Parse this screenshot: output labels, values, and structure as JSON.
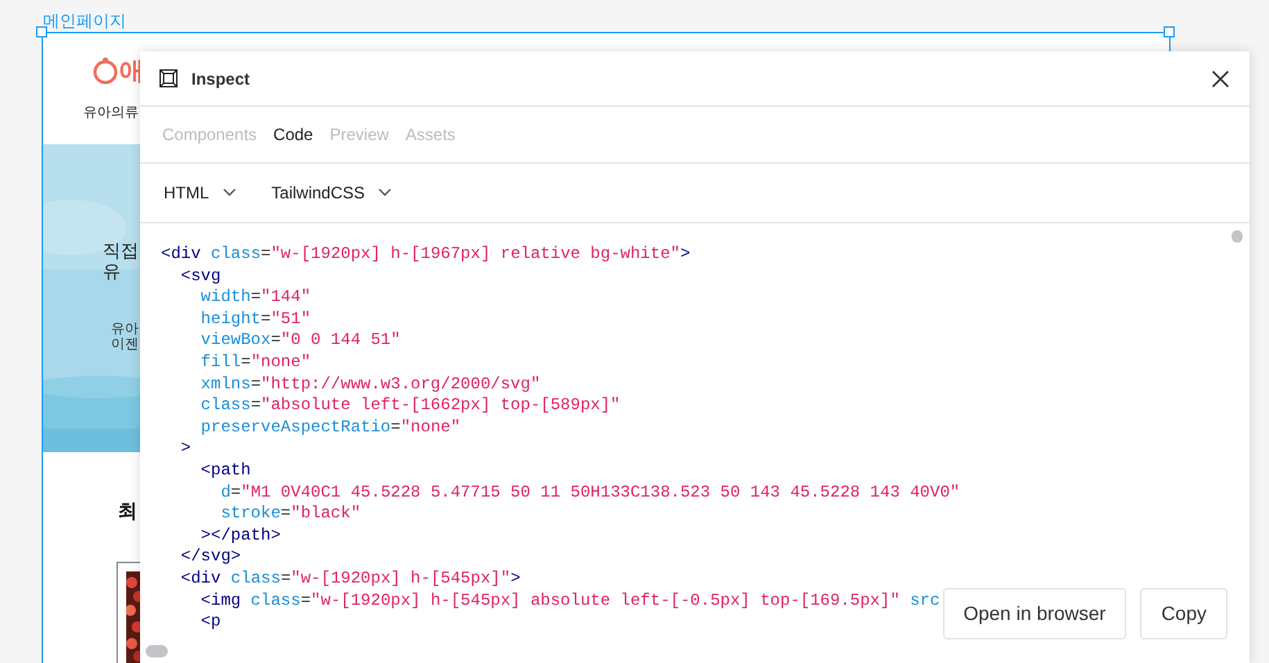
{
  "canvas": {
    "frame_label": "메인페이지",
    "page": {
      "logo_text": "애",
      "nav": [
        "유아의류"
      ],
      "hero": {
        "kind": "picture",
        "heading_lines": [
          "직접",
          "유"
        ],
        "subtext_lines": [
          "유아",
          "이젠"
        ]
      },
      "section_heading": "최",
      "product": {
        "kind": "picture"
      }
    }
  },
  "dialog": {
    "title": "Inspect",
    "tabs": [
      {
        "label": "Components",
        "selected": false
      },
      {
        "label": "Code",
        "selected": true
      },
      {
        "label": "Preview",
        "selected": false
      },
      {
        "label": "Assets",
        "selected": false
      }
    ],
    "dropdowns": [
      {
        "label": "HTML"
      },
      {
        "label": "TailwindCSS"
      }
    ],
    "code_lines": [
      [
        {
          "kind": "tag",
          "text": "<div"
        },
        {
          "kind": "attr",
          "text": " class"
        },
        {
          "kind": "plain",
          "text": "="
        },
        {
          "kind": "value",
          "text": "\"w-[1920px] h-[1967px] relative bg-white\""
        },
        {
          "kind": "tag",
          "text": ">"
        }
      ],
      [
        {
          "kind": "tag",
          "text": "  <svg"
        }
      ],
      [
        {
          "kind": "attr",
          "text": "    width"
        },
        {
          "kind": "plain",
          "text": "="
        },
        {
          "kind": "value",
          "text": "\"144\""
        }
      ],
      [
        {
          "kind": "attr",
          "text": "    height"
        },
        {
          "kind": "plain",
          "text": "="
        },
        {
          "kind": "value",
          "text": "\"51\""
        }
      ],
      [
        {
          "kind": "attr",
          "text": "    viewBox"
        },
        {
          "kind": "plain",
          "text": "="
        },
        {
          "kind": "value",
          "text": "\"0 0 144 51\""
        }
      ],
      [
        {
          "kind": "attr",
          "text": "    fill"
        },
        {
          "kind": "plain",
          "text": "="
        },
        {
          "kind": "value",
          "text": "\"none\""
        }
      ],
      [
        {
          "kind": "attr",
          "text": "    xmlns"
        },
        {
          "kind": "plain",
          "text": "="
        },
        {
          "kind": "value",
          "text": "\"http://www.w3.org/2000/svg\""
        }
      ],
      [
        {
          "kind": "attr",
          "text": "    class"
        },
        {
          "kind": "plain",
          "text": "="
        },
        {
          "kind": "value",
          "text": "\"absolute left-[1662px] top-[589px]\""
        }
      ],
      [
        {
          "kind": "attr",
          "text": "    preserveAspectRatio"
        },
        {
          "kind": "plain",
          "text": "="
        },
        {
          "kind": "value",
          "text": "\"none\""
        }
      ],
      [
        {
          "kind": "tag",
          "text": "  >"
        }
      ],
      [
        {
          "kind": "tag",
          "text": "    <path"
        }
      ],
      [
        {
          "kind": "attr",
          "text": "      d"
        },
        {
          "kind": "plain",
          "text": "="
        },
        {
          "kind": "value",
          "text": "\"M1 0V40C1 45.5228 5.47715 50 11 50H133C138.523 50 143 45.5228 143 40V0\""
        }
      ],
      [
        {
          "kind": "attr",
          "text": "      stroke"
        },
        {
          "kind": "plain",
          "text": "="
        },
        {
          "kind": "value",
          "text": "\"black\""
        }
      ],
      [
        {
          "kind": "tag",
          "text": "    ></path>"
        }
      ],
      [
        {
          "kind": "tag",
          "text": "  </svg>"
        }
      ],
      [
        {
          "kind": "tag",
          "text": "  <div"
        },
        {
          "kind": "attr",
          "text": " class"
        },
        {
          "kind": "plain",
          "text": "="
        },
        {
          "kind": "value",
          "text": "\"w-[1920px] h-[545px]\""
        },
        {
          "kind": "tag",
          "text": ">"
        }
      ],
      [
        {
          "kind": "tag",
          "text": "    <img"
        },
        {
          "kind": "attr",
          "text": " class"
        },
        {
          "kind": "plain",
          "text": "="
        },
        {
          "kind": "value",
          "text": "\"w-[1920px] h-[545px] absolute left-[-0.5px] top-[169.5px]\""
        },
        {
          "kind": "attr",
          "text": " src"
        }
      ],
      [
        {
          "kind": "tag",
          "text": "    <p"
        }
      ]
    ],
    "buttons": [
      "Open in browser",
      "Copy"
    ]
  }
}
